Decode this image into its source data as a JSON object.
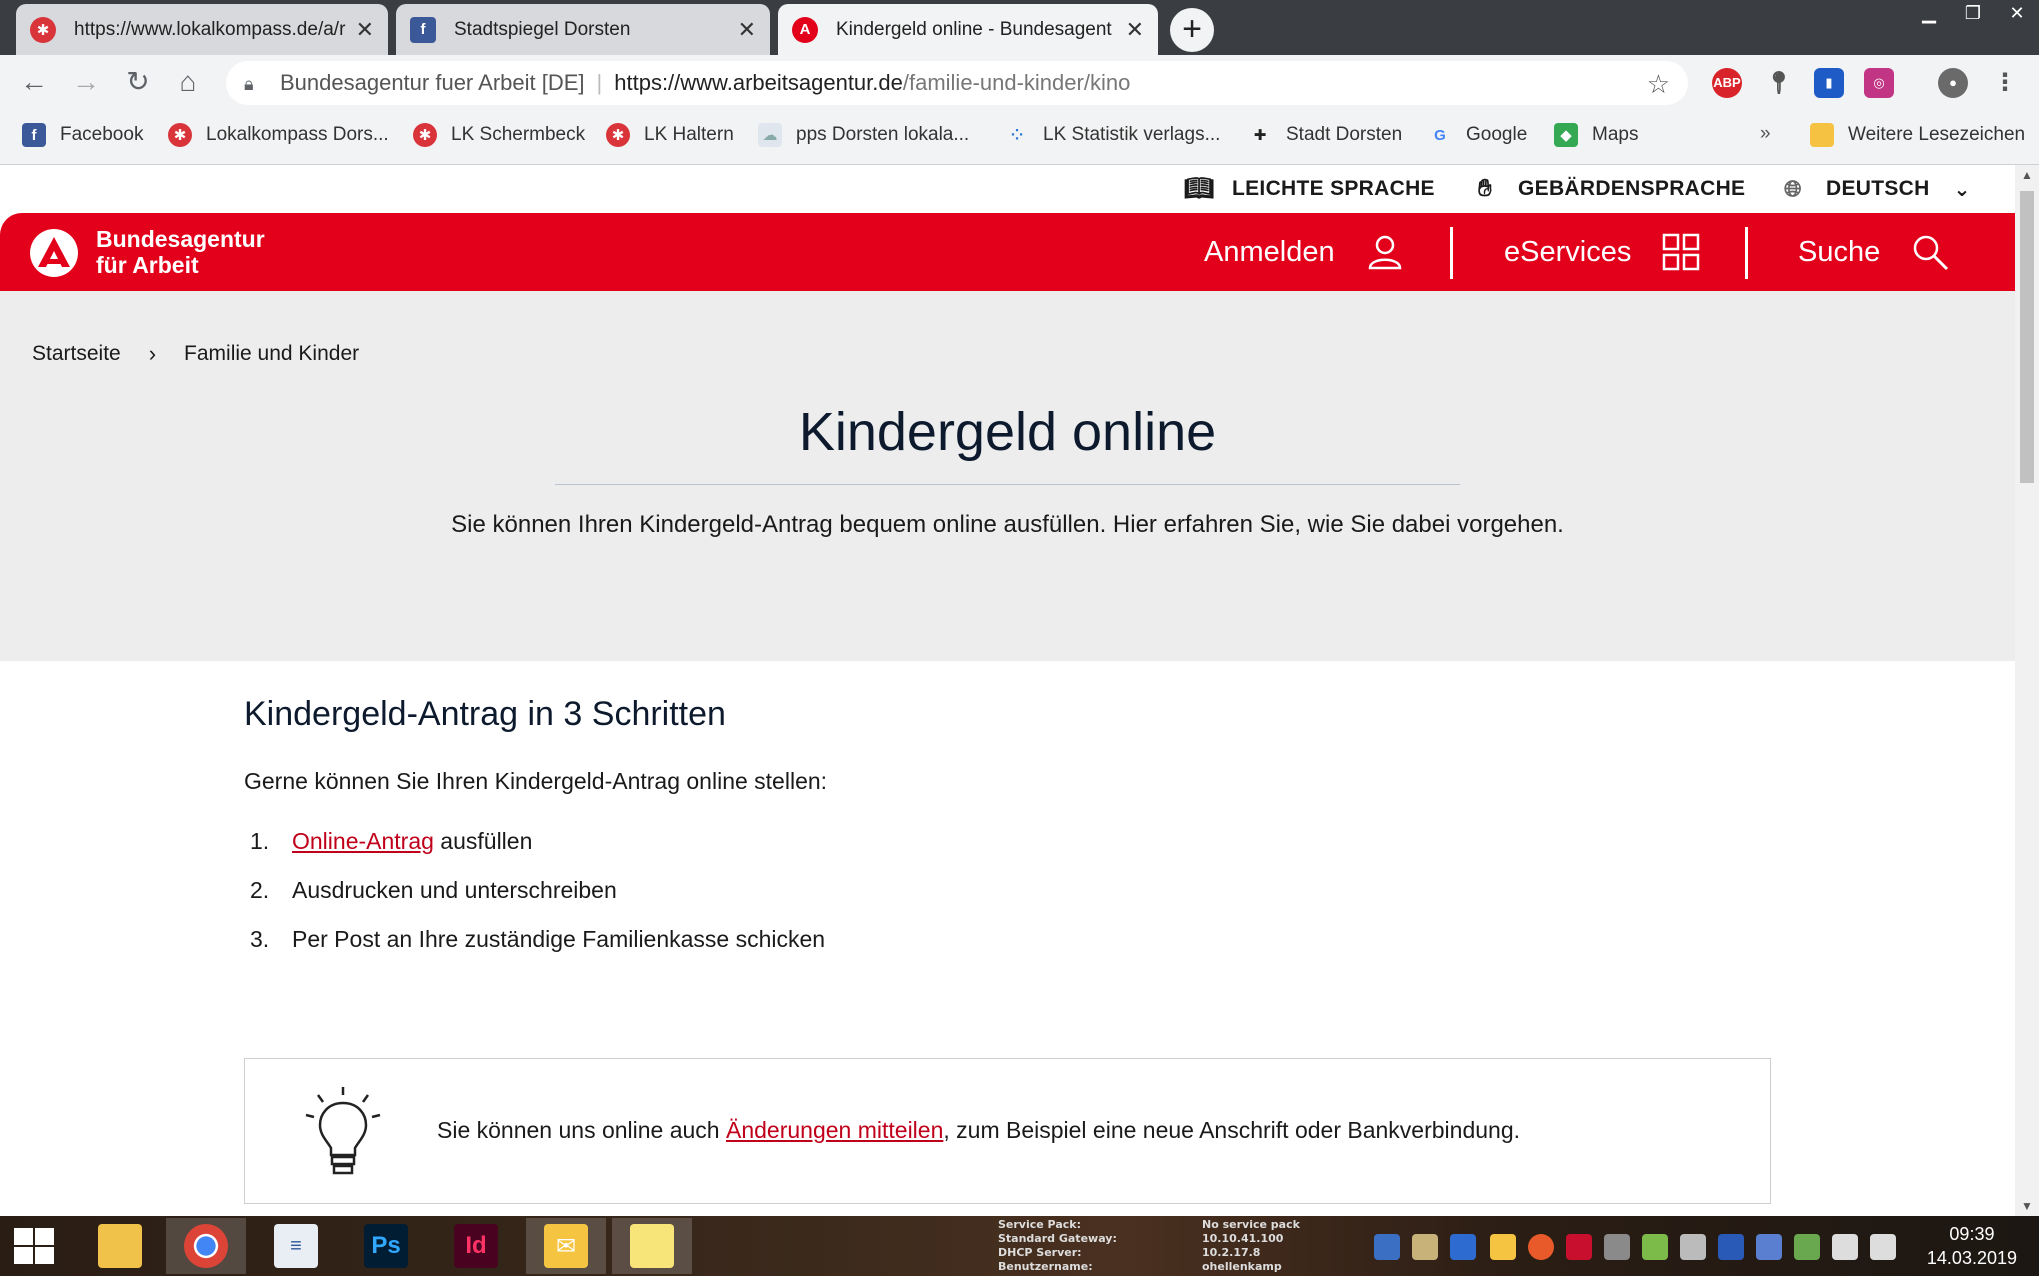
{
  "browser": {
    "tabs": [
      {
        "title": "https://www.lokalkompass.de/a/r",
        "active": false
      },
      {
        "title": "Stadtspiegel Dorsten",
        "active": false
      },
      {
        "title": "Kindergeld online - Bundesagent",
        "active": true
      }
    ],
    "new_tab": "+",
    "address": {
      "site_name": "Bundesagentur fuer Arbeit [DE]",
      "url_host": "https://www.arbeitsagentur.de",
      "url_path": "/familie-und-kinder/kino"
    },
    "extensions": [
      "ABP"
    ],
    "bookmarks": [
      "Facebook",
      "Lokalkompass Dors...",
      "LK Schermbeck",
      "LK Haltern",
      "pps Dorsten lokala...",
      "LK Statistik verlags...",
      "Stadt Dorsten",
      "Google",
      "Maps"
    ],
    "bookmarks_overflow": "»",
    "other_bookmarks": "Weitere Lesezeichen"
  },
  "site": {
    "utility": {
      "easy_language": "LEICHTE SPRACHE",
      "sign_language": "GEBÄRDENSPRACHE",
      "language": "DEUTSCH"
    },
    "logo": {
      "line1": "Bundesagentur",
      "line2": "für Arbeit"
    },
    "nav": {
      "login": "Anmelden",
      "eservices": "eServices",
      "search": "Suche"
    },
    "breadcrumb": [
      "Startseite",
      "Familie und Kinder"
    ],
    "breadcrumb_sep": "›",
    "hero": {
      "title": "Kindergeld online",
      "subtitle": "Sie können Ihren Kindergeld-Antrag bequem online ausfüllen. Hier erfahren Sie, wie Sie dabei vorgehen."
    },
    "steps_section": {
      "heading": "Kindergeld-Antrag in 3 Schritten",
      "intro": "Gerne können Sie Ihren Kindergeld-Antrag online stellen:",
      "steps": [
        {
          "num": "1.",
          "link": "Online-Antrag",
          "text": " ausfüllen"
        },
        {
          "num": "2.",
          "text": "Ausdrucken und unterschreiben"
        },
        {
          "num": "3.",
          "text": "Per Post an Ihre zuständige Familienkasse schicken"
        }
      ]
    },
    "tip": {
      "before": "Sie können uns online auch ",
      "link": "Änderungen mitteilen",
      "after": ", zum Beispiel eine neue Anschrift oder Bankverbindung."
    }
  },
  "taskbar": {
    "sysinfo_labels": [
      "Service Pack:",
      "Standard Gateway:",
      "DHCP Server:",
      "Benutzername:"
    ],
    "sysinfo_values": [
      "No service pack",
      "10.10.41.100",
      "10.2.17.8",
      "ohellenkamp"
    ],
    "time": "09:39",
    "date": "14.03.2019"
  },
  "colors": {
    "brand_red": "#e2001a",
    "link_red": "#c0001a",
    "hero_bg": "#ededed",
    "title_navy": "#0d1a2e"
  }
}
